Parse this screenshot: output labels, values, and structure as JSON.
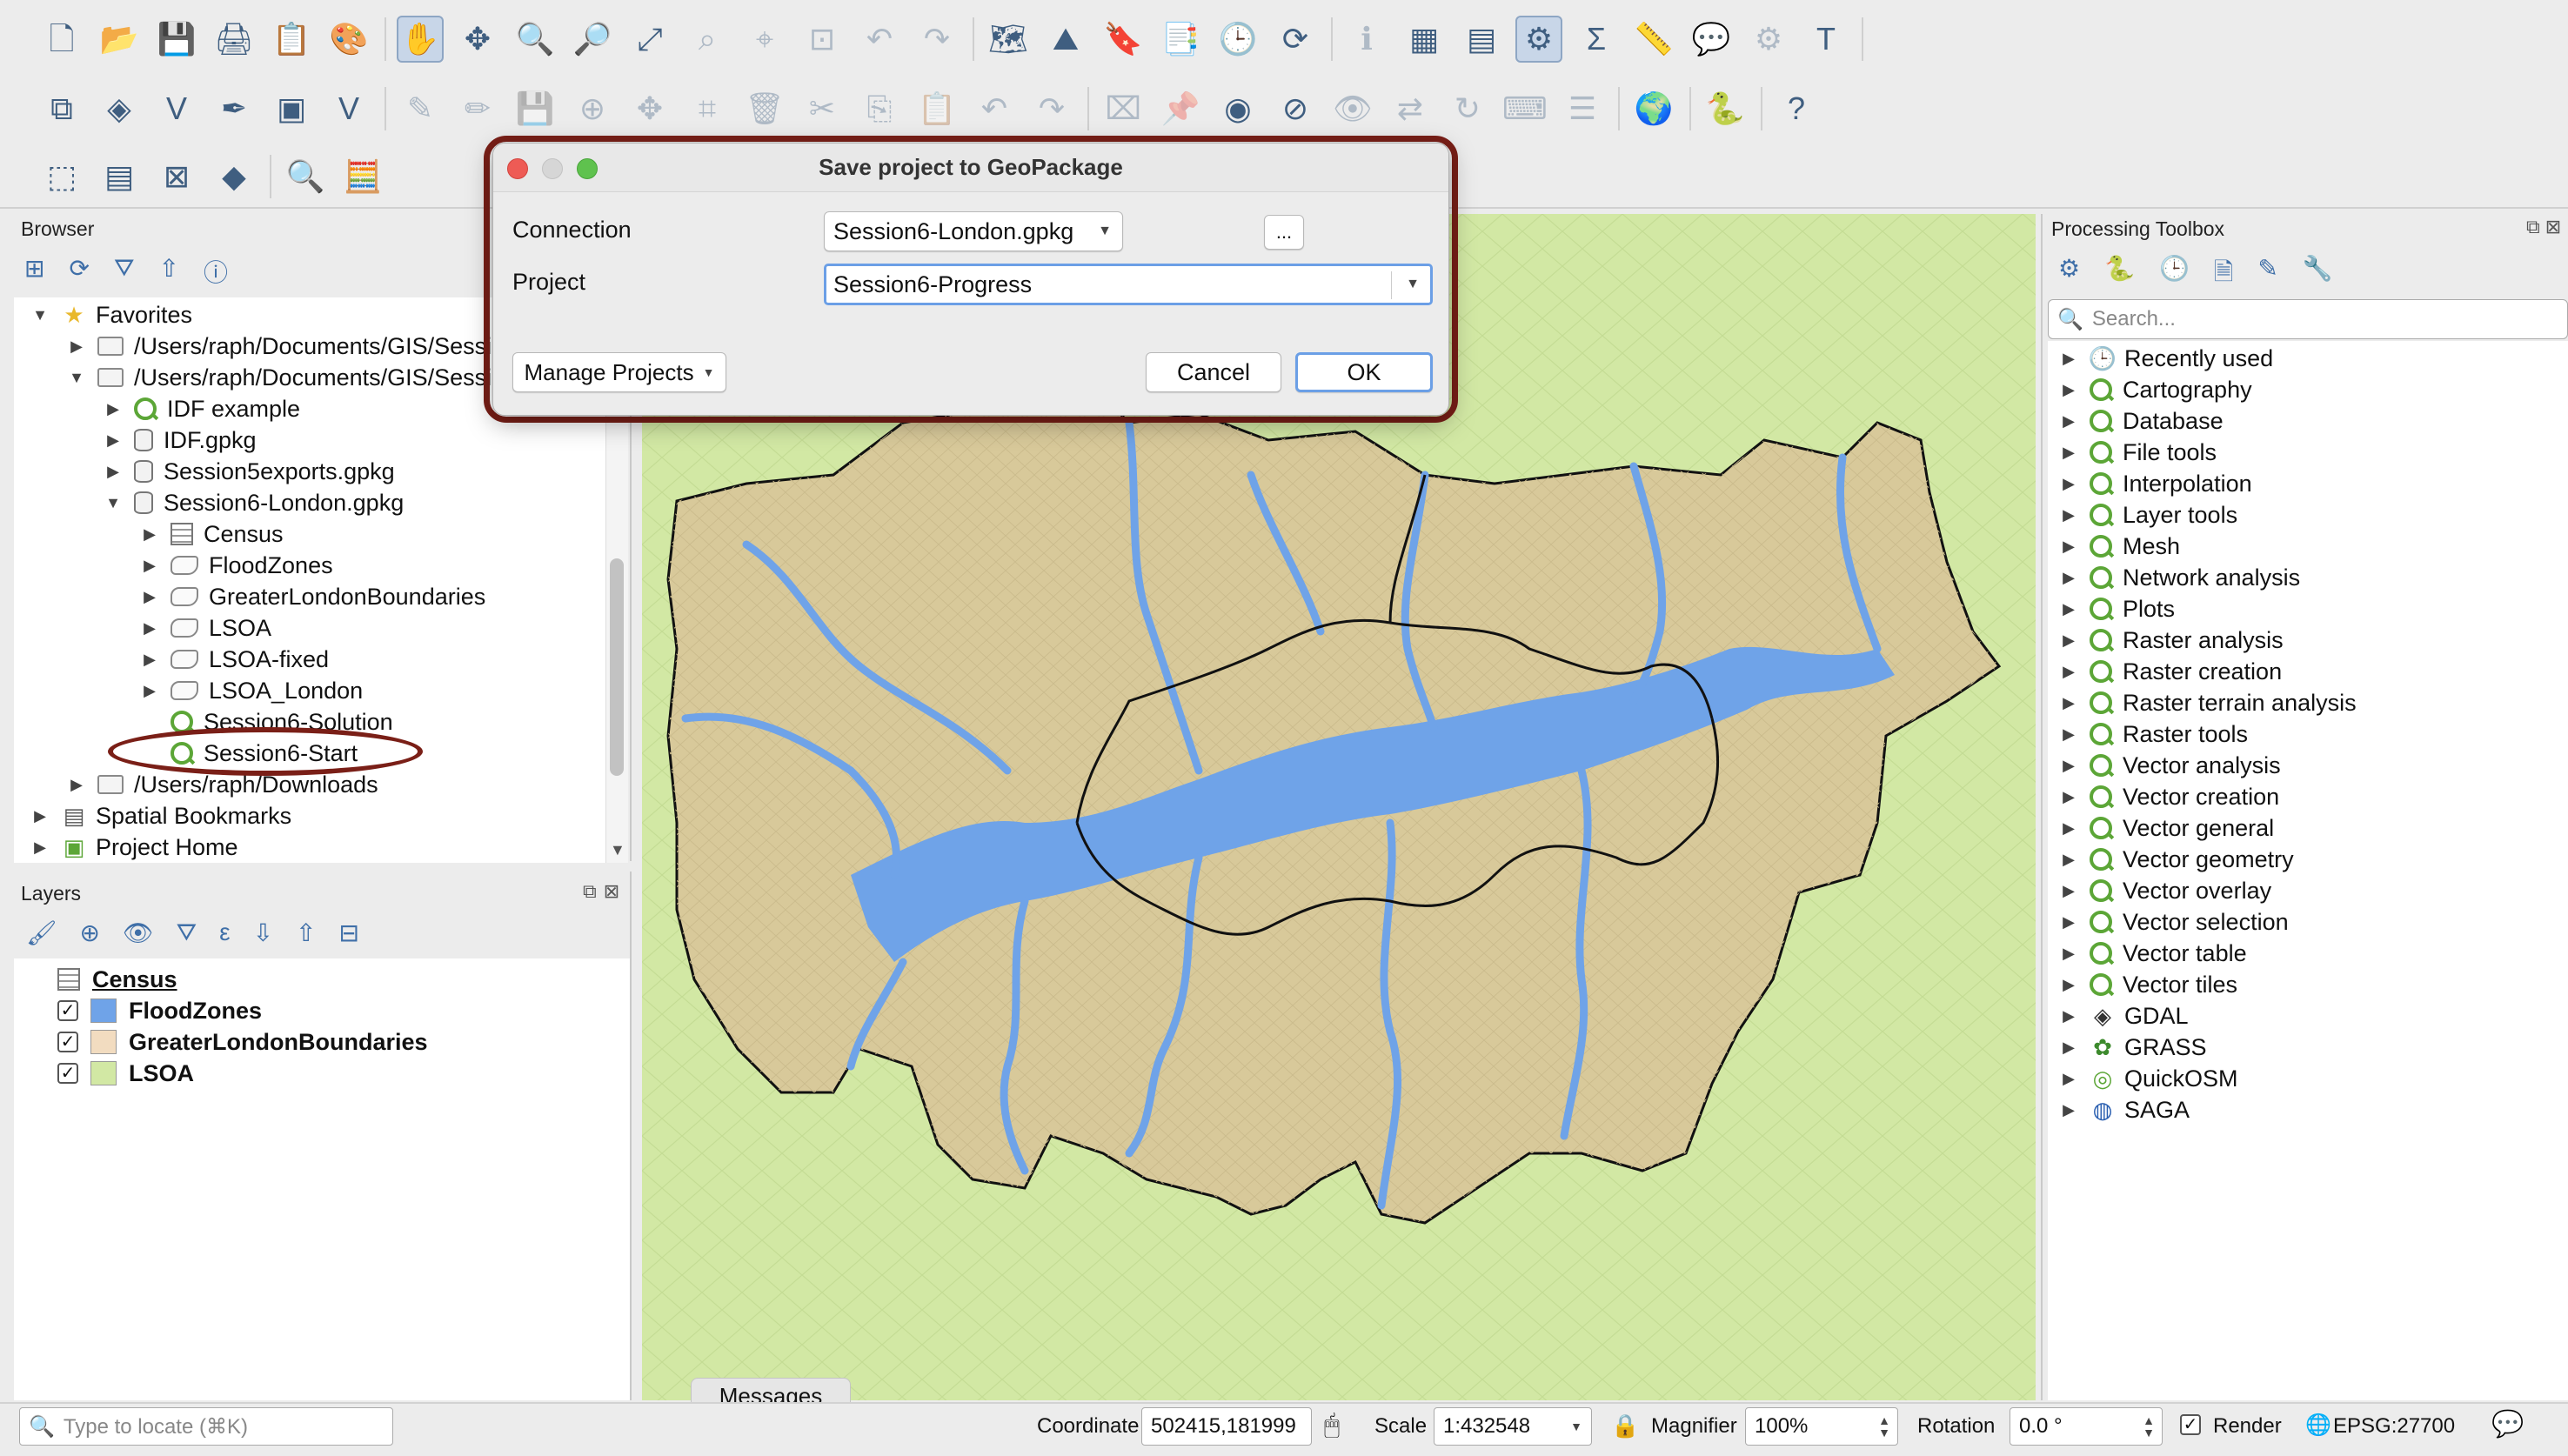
{
  "toolbar": {
    "row1": [
      "new-project-icon",
      "open-project-icon",
      "save-project-icon",
      "new-print-layout-icon",
      "layout-manager-icon",
      "style-manager-icon",
      "pan-icon",
      "pan-to-selection-icon",
      "zoom-in-icon",
      "zoom-out-icon",
      "zoom-full-icon",
      "zoom-to-selection-icon",
      "zoom-to-layer-icon",
      "zoom-native-icon",
      "zoom-last-icon",
      "zoom-next-icon",
      "new-map-view-icon",
      "new-3d-view-icon",
      "new-bookmark-icon",
      "show-bookmarks-icon",
      "temporal-controller-icon",
      "refresh-icon",
      "identify-icon",
      "attribute-table-icon",
      "statistics-icon",
      "processing-toolbox-icon",
      "sum-icon",
      "measure-icon",
      "tips-icon",
      "settings-icon",
      "text-annotation-icon"
    ],
    "row2": [
      "data-source-manager-icon",
      "new-geopackage-icon",
      "digitize-icon",
      "edit-pencil-icon",
      "georeferencer-icon",
      "vertex-tool-icon",
      "current-edits-icon",
      "toggle-editing-icon",
      "save-edits-icon",
      "add-feature-icon",
      "move-feature-icon",
      "node-tool-icon",
      "delete-selected-icon",
      "cut-icon",
      "copy-icon",
      "paste-icon",
      "undo-icon",
      "redo-icon",
      "label-icon",
      "pin-labels-icon",
      "label-highlight-icon",
      "label-remove-icon",
      "show-hide-labels-icon",
      "move-label-icon",
      "rotate-label-icon",
      "change-label-icon",
      "label-props-icon",
      "quickosm-icon",
      "python-console-icon",
      "help-icon"
    ],
    "row3": [
      "select-features-icon",
      "select-by-value-icon",
      "deselect-icon",
      "select-location-icon",
      "locator-icon",
      "field-calculator-icon"
    ]
  },
  "browser": {
    "title": "Browser",
    "tree": [
      {
        "label": "Favorites",
        "icon": "star-icon",
        "indent": 0,
        "arrow": "▼"
      },
      {
        "label": "/Users/raph/Documents/GIS/Sessi",
        "icon": "folder-icon",
        "indent": 1,
        "arrow": "▶"
      },
      {
        "label": "/Users/raph/Documents/GIS/Sessi",
        "icon": "folder-icon",
        "indent": 1,
        "arrow": "▼"
      },
      {
        "label": "IDF example",
        "icon": "qgis-project-icon",
        "indent": 2,
        "arrow": "▶"
      },
      {
        "label": "IDF.gpkg",
        "icon": "geopackage-icon",
        "indent": 2,
        "arrow": "▶"
      },
      {
        "label": "Session5exports.gpkg",
        "icon": "geopackage-icon",
        "indent": 2,
        "arrow": "▶"
      },
      {
        "label": "Session6-London.gpkg",
        "icon": "geopackage-icon",
        "indent": 2,
        "arrow": "▼"
      },
      {
        "label": "Census",
        "icon": "table-icon",
        "indent": 3,
        "arrow": "▶"
      },
      {
        "label": "FloodZones",
        "icon": "polygon-icon",
        "indent": 3,
        "arrow": "▶"
      },
      {
        "label": "GreaterLondonBoundaries",
        "icon": "polygon-icon",
        "indent": 3,
        "arrow": "▶"
      },
      {
        "label": "LSOA",
        "icon": "polygon-icon",
        "indent": 3,
        "arrow": "▶"
      },
      {
        "label": "LSOA-fixed",
        "icon": "polygon-icon",
        "indent": 3,
        "arrow": "▶"
      },
      {
        "label": "LSOA_London",
        "icon": "polygon-icon",
        "indent": 3,
        "arrow": "▶"
      },
      {
        "label": "Session6-Solution",
        "icon": "qgis-project-icon",
        "indent": 3,
        "arrow": ""
      },
      {
        "label": "Session6-Start",
        "icon": "qgis-project-icon",
        "indent": 3,
        "arrow": ""
      },
      {
        "label": "/Users/raph/Downloads",
        "icon": "folder-icon",
        "indent": 1,
        "arrow": "▶"
      },
      {
        "label": "Spatial Bookmarks",
        "icon": "bookmark-icon",
        "indent": 0,
        "arrow": "▶"
      },
      {
        "label": "Project Home",
        "icon": "project-home-icon",
        "indent": 0,
        "arrow": "▶"
      }
    ]
  },
  "layers": {
    "title": "Layers",
    "items": [
      {
        "label": "Census",
        "checked": false,
        "swatch": "table",
        "color": "#ffffff",
        "selected": true
      },
      {
        "label": "FloodZones",
        "checked": true,
        "swatch": "fill",
        "color": "#6fa3e8",
        "selected": false
      },
      {
        "label": "GreaterLondonBoundaries",
        "checked": true,
        "swatch": "fill",
        "color": "#f2dcc0",
        "selected": false
      },
      {
        "label": "LSOA",
        "checked": true,
        "swatch": "fill",
        "color": "#d2e8a4",
        "selected": false
      }
    ]
  },
  "dialog": {
    "title": "Save project to GeoPackage",
    "connection_label": "Connection",
    "connection_value": "Session6-London.gpkg",
    "browse_label": "...",
    "project_label": "Project",
    "project_value": "Session6-Progress",
    "manage_label": "Manage Projects",
    "cancel_label": "Cancel",
    "ok_label": "OK"
  },
  "processing": {
    "title": "Processing Toolbox",
    "search_placeholder": "Search...",
    "items": [
      {
        "label": "Recently used",
        "icon": "clock-icon"
      },
      {
        "label": "Cartography",
        "icon": "qgis-icon"
      },
      {
        "label": "Database",
        "icon": "qgis-icon"
      },
      {
        "label": "File tools",
        "icon": "qgis-icon"
      },
      {
        "label": "Interpolation",
        "icon": "qgis-icon"
      },
      {
        "label": "Layer tools",
        "icon": "qgis-icon"
      },
      {
        "label": "Mesh",
        "icon": "qgis-icon"
      },
      {
        "label": "Network analysis",
        "icon": "qgis-icon"
      },
      {
        "label": "Plots",
        "icon": "qgis-icon"
      },
      {
        "label": "Raster analysis",
        "icon": "qgis-icon"
      },
      {
        "label": "Raster creation",
        "icon": "qgis-icon"
      },
      {
        "label": "Raster terrain analysis",
        "icon": "qgis-icon"
      },
      {
        "label": "Raster tools",
        "icon": "qgis-icon"
      },
      {
        "label": "Vector analysis",
        "icon": "qgis-icon"
      },
      {
        "label": "Vector creation",
        "icon": "qgis-icon"
      },
      {
        "label": "Vector general",
        "icon": "qgis-icon"
      },
      {
        "label": "Vector geometry",
        "icon": "qgis-icon"
      },
      {
        "label": "Vector overlay",
        "icon": "qgis-icon"
      },
      {
        "label": "Vector selection",
        "icon": "qgis-icon"
      },
      {
        "label": "Vector table",
        "icon": "qgis-icon"
      },
      {
        "label": "Vector tiles",
        "icon": "qgis-icon"
      },
      {
        "label": "GDAL",
        "icon": "gdal-icon"
      },
      {
        "label": "GRASS",
        "icon": "grass-icon"
      },
      {
        "label": "QuickOSM",
        "icon": "quickosm-icon"
      },
      {
        "label": "SAGA",
        "icon": "saga-icon"
      }
    ]
  },
  "map": {
    "background": "#d2e8a4",
    "london_fill": "#d8c99a",
    "water": "#6fa3e8",
    "messages_tab": "Messages"
  },
  "status": {
    "locator_placeholder": "Type to locate (⌘K)",
    "coordinate_label": "Coordinate",
    "coordinate_value": "502415,181999",
    "scale_label": "Scale",
    "scale_value": "1:432548",
    "magnifier_label": "Magnifier",
    "magnifier_value": "100%",
    "rotation_label": "Rotation",
    "rotation_value": "0.0 °",
    "render_label": "Render",
    "crs_label": "EPSG:27700"
  },
  "colors": {
    "annotation_ring": "#7a1f17",
    "dialog_highlight": "#7a1f17"
  }
}
